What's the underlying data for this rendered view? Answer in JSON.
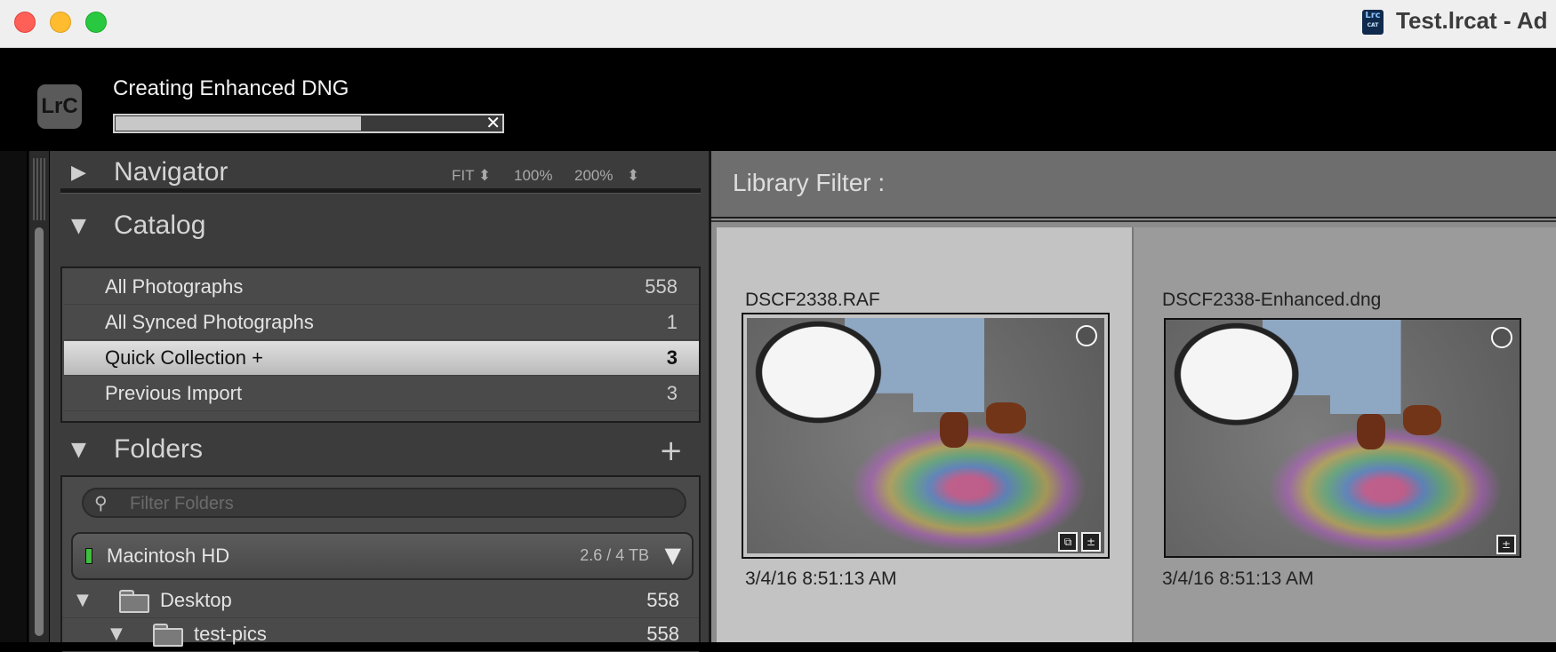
{
  "window": {
    "title": "Test.lrcat - Ad",
    "doc_icon": {
      "line1": "Lrc",
      "line2": "CAT"
    }
  },
  "identity": {
    "logo_text": "LrC",
    "progress": {
      "label": "Creating Enhanced DNG",
      "fraction": 0.68,
      "cancel_glyph": "✕"
    }
  },
  "navigator": {
    "title": "Navigator",
    "triangle": "▶",
    "zoom": {
      "fit": "FIT ⬍",
      "z100": "100%",
      "z200": "200%",
      "more": "⬍"
    }
  },
  "catalog": {
    "title": "Catalog",
    "triangle": "▼",
    "items": [
      {
        "label": "All Photographs",
        "count": "558"
      },
      {
        "label": "All Synced Photographs",
        "count": "1"
      },
      {
        "label": "Quick Collection  +",
        "count": "3",
        "selected": true
      },
      {
        "label": "Previous Import",
        "count": "3"
      }
    ]
  },
  "folders": {
    "title": "Folders",
    "triangle": "▼",
    "add_glyph": "+",
    "filter_placeholder": "Filter Folders",
    "search_glyph": "⚲",
    "volume": {
      "name": "Macintosh HD",
      "size": "2.6 / 4 TB",
      "menu_glyph": "▼"
    },
    "rows": [
      {
        "label": "Desktop",
        "count": "558",
        "triangle": "▼"
      },
      {
        "label": "test-pics",
        "count": "558",
        "triangle": "▼"
      }
    ]
  },
  "library": {
    "filter_label": "Library Filter :",
    "photos": [
      {
        "filename": "DSCF2338.RAF",
        "date": "3/4/16 8:51:13 AM",
        "badges": [
          "⧉",
          "±"
        ]
      },
      {
        "filename": "DSCF2338-Enhanced.dng",
        "date": "3/4/16 8:51:13 AM",
        "badges": [
          "±"
        ]
      }
    ]
  },
  "colors": {
    "progress_fill": "#c8c8c8",
    "selected_row": "#d0d0d0",
    "volume_indicator": "#3fbf3f"
  }
}
